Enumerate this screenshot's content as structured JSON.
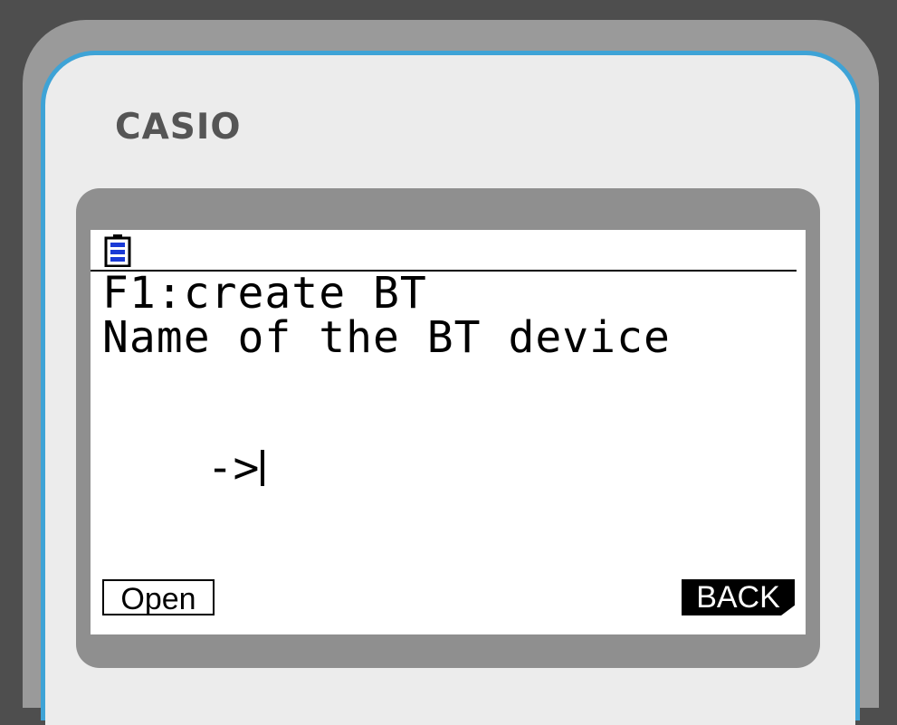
{
  "brand": "CASIO",
  "status": {
    "battery_icon": "battery-icon"
  },
  "screen": {
    "line1": "F1:create BT",
    "line2": "Name of the BT device",
    "prompt": "->"
  },
  "softkeys": {
    "f1_label": "Open",
    "f6_label": "BACK"
  },
  "colors": {
    "accent_border": "#3ea3d6",
    "battery": "#1a3ad6",
    "lcd_background": "#ffffff"
  }
}
